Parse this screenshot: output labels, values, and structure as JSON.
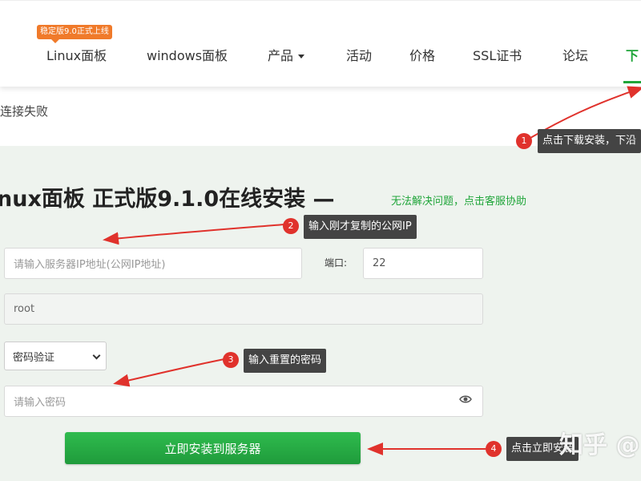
{
  "nav": {
    "badge": "稳定版9.0正式上线",
    "items": [
      "Linux面板",
      "windows面板",
      "产品",
      "活动",
      "价格",
      "SSL证书",
      "论坛",
      "下"
    ]
  },
  "status": {
    "fail_text": "连接失败"
  },
  "form": {
    "title": "nux面板 正式版9.1.0在线安装 —",
    "help_link": "无法解决问题，点击客服协助",
    "ip_placeholder": "请输入服务器IP地址(公网IP地址)",
    "port_label": "端口:",
    "port_value": "22",
    "user_value": "root",
    "auth_method": "密码验证",
    "password_placeholder": "请输入密码",
    "install_button": "立即安装到服务器"
  },
  "annotations": [
    {
      "num": "1",
      "text": "点击下载安装，下沿"
    },
    {
      "num": "2",
      "text": "输入刚才复制的公网IP"
    },
    {
      "num": "3",
      "text": "输入重置的密码"
    },
    {
      "num": "4",
      "text": "点击立即安装"
    }
  ],
  "watermark": "知乎 @",
  "colors": {
    "brand_green": "#20a53a",
    "badge_orange": "#f07a2a",
    "marker_red": "#e0322c",
    "tooltip_dark": "#444444"
  }
}
